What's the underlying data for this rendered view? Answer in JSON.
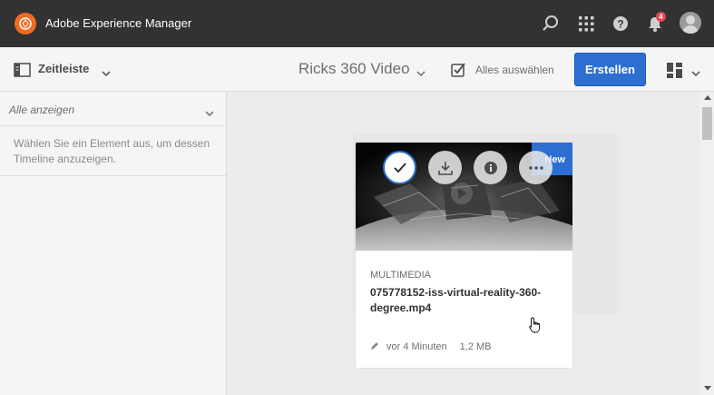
{
  "header": {
    "app_title": "Adobe Experience Manager",
    "notification_count": "4",
    "icons": [
      "adobe-logo",
      "search-icon",
      "apps-grid-icon",
      "help-icon",
      "bell-icon",
      "user-avatar"
    ]
  },
  "actionbar": {
    "rail_label": "Zeitleiste",
    "folder_title": "Ricks 360 Video",
    "select_all_label": "Alles auswählen",
    "create_label": "Erstellen",
    "accent_color": "#2d6fd1"
  },
  "rail": {
    "filter_label": "Alle anzeigen",
    "empty_message": "Wählen Sie ein Element aus, um dessen Timeline anzuzeigen."
  },
  "card": {
    "badge": "New",
    "type": "MULTIMEDIA",
    "name": "075778152-iss-virtual-reality-360-degree.mp4",
    "modified": "vor 4 Minuten",
    "size": "1,2 MB",
    "selected": true,
    "quick_actions": [
      "check-icon",
      "download-icon",
      "info-icon",
      "more-icon"
    ]
  }
}
